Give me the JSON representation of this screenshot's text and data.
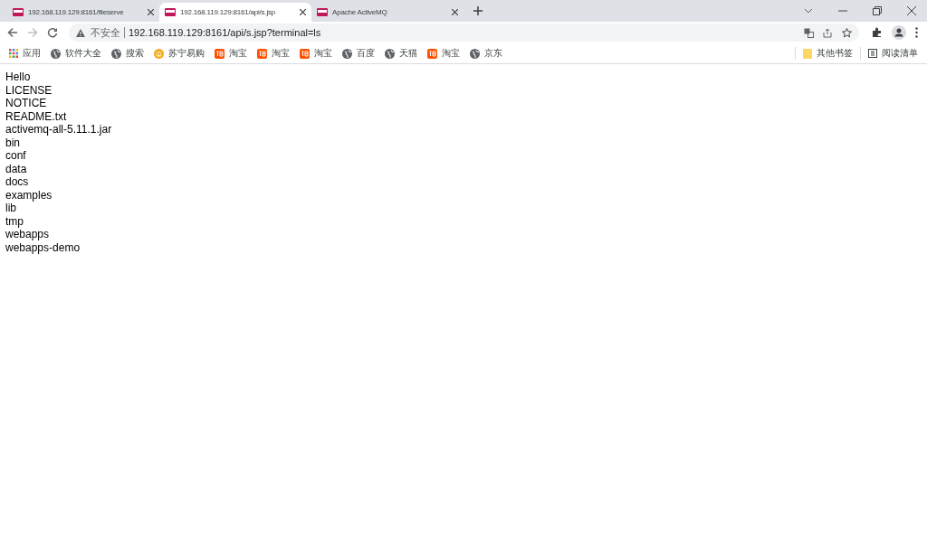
{
  "tabs": [
    {
      "title": "192.168.119.129:8161/fileserve",
      "selected": false
    },
    {
      "title": "192.168.119.129:8161/api/s.jsp",
      "selected": true
    },
    {
      "title": "Apache ActiveMQ",
      "selected": false
    }
  ],
  "toolbar": {
    "security_label": "不安全",
    "url": "192.168.119.129:8161/api/s.jsp?terminal=ls"
  },
  "bookmarks": [
    {
      "label": "应用",
      "kind": "apps"
    },
    {
      "label": "软件大全",
      "kind": "globe"
    },
    {
      "label": "搜索",
      "kind": "globe"
    },
    {
      "label": "苏宁易购",
      "kind": "lion"
    },
    {
      "label": "淘宝",
      "kind": "taobao"
    },
    {
      "label": "淘宝",
      "kind": "taobao"
    },
    {
      "label": "淘宝",
      "kind": "taobao"
    },
    {
      "label": "百度",
      "kind": "globe"
    },
    {
      "label": "天猫",
      "kind": "globe"
    },
    {
      "label": "淘宝",
      "kind": "taobao"
    },
    {
      "label": "京东",
      "kind": "globe"
    }
  ],
  "bookmarks_right": [
    {
      "label": "其他书签",
      "kind": "folder"
    },
    {
      "label": "阅读清单",
      "kind": "reading"
    }
  ],
  "content_lines": [
    "Hello",
    "LICENSE",
    "NOTICE",
    "README.txt",
    "activemq-all-5.11.1.jar",
    "bin",
    "conf",
    "data",
    "docs",
    "examples",
    "lib",
    "tmp",
    "webapps",
    "webapps-demo"
  ]
}
